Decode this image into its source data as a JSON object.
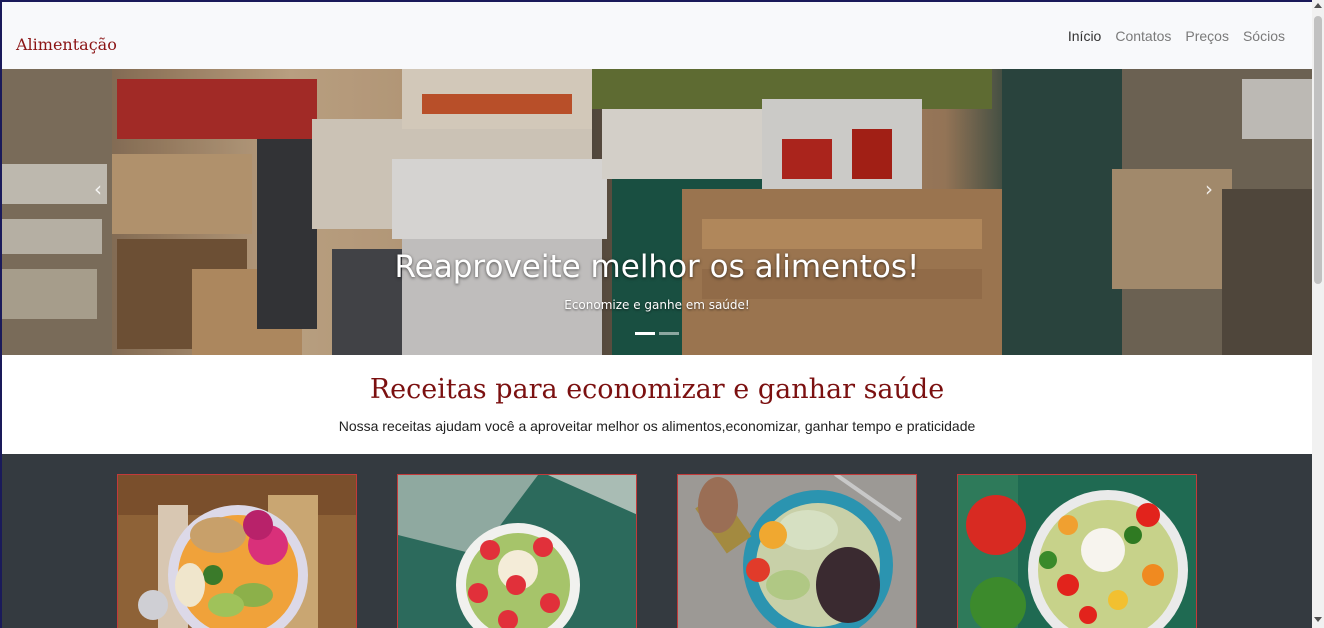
{
  "navbar": {
    "brand": "Alimentação",
    "links": [
      "Início",
      "Contatos",
      "Preços",
      "Sócios"
    ],
    "active_index": 0
  },
  "hero": {
    "title": "Reaproveite melhor os alimentos!",
    "subtitle": "Economize e ganhe em saúde!",
    "prev_icon": "‹",
    "next_icon": "›",
    "slides": 2,
    "active_slide": 0
  },
  "recipes": {
    "title": "Receitas para economizar e ganhar saúde",
    "subtitle": "Nossa receitas ajudam você a aproveitar melhor os alimentos,economizar, ganhar tempo e praticidade"
  },
  "cards": [
    {
      "image": "smoothie-bowl-image"
    },
    {
      "image": "kiwi-strawberry-bowl-image"
    },
    {
      "image": "salad-olive-oil-image"
    },
    {
      "image": "caprese-salad-image"
    }
  ],
  "colors": {
    "brand": "#8b1414",
    "section_title": "#7b1010",
    "cards_bg": "#343a40",
    "card_border": "#c23a3a"
  }
}
